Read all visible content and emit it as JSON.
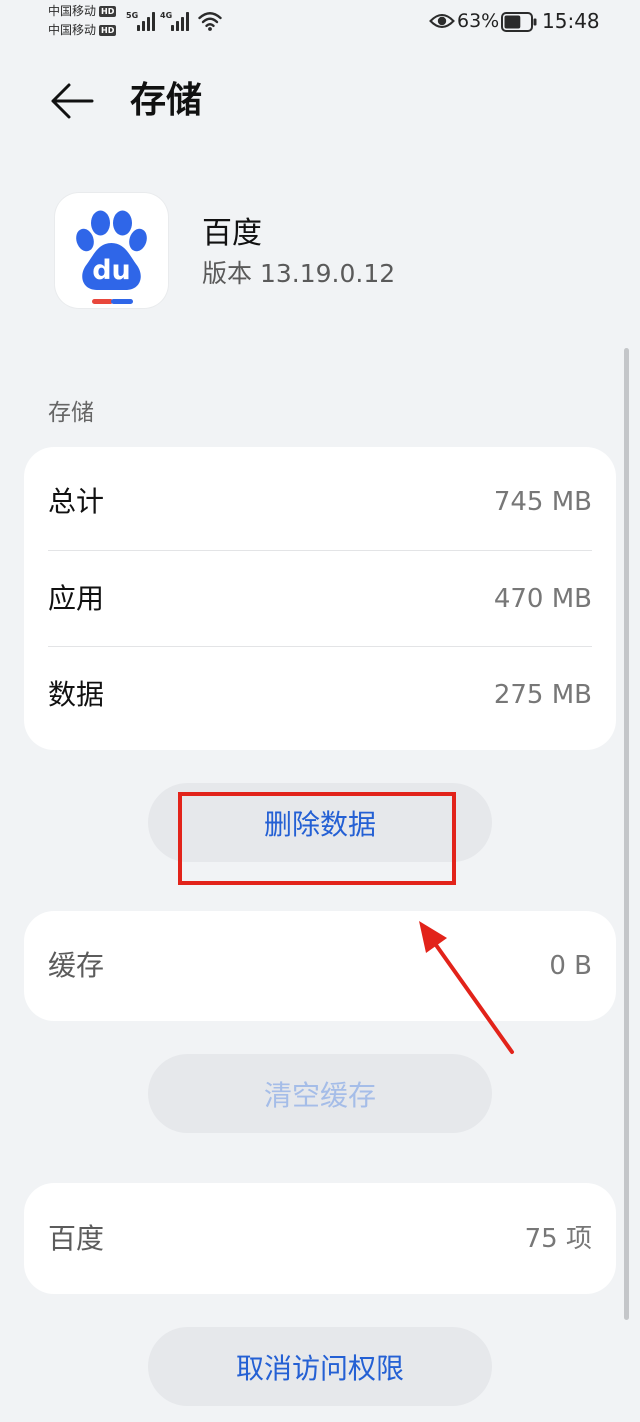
{
  "status_bar": {
    "carrier_1": "中国移动",
    "carrier_2": "中国移动",
    "hd_badge": "HD",
    "network_1": "5G",
    "network_2": "4G",
    "battery_percent": "63%",
    "battery_level": 0.63,
    "time": "15:48"
  },
  "header": {
    "title": "存储"
  },
  "app": {
    "name": "百度",
    "version": "版本 13.19.0.12",
    "logo_text": "du"
  },
  "storage_section": {
    "label": "存储",
    "rows": [
      {
        "label": "总计",
        "value": "745 MB"
      },
      {
        "label": "应用",
        "value": "470 MB"
      },
      {
        "label": "数据",
        "value": "275 MB"
      }
    ],
    "delete_button": "删除数据"
  },
  "cache": {
    "label": "缓存",
    "value": "0 B",
    "clear_button": "清空缓存"
  },
  "access": {
    "label": "百度",
    "value": "75 项",
    "revoke_button": "取消访问权限"
  },
  "icons": {
    "back": "back-arrow-icon",
    "signal": "signal-bars-icon",
    "wifi": "wifi-icon",
    "eye": "eye-icon",
    "battery": "battery-icon"
  },
  "colors": {
    "background": "#f1f3f5",
    "accent": "#2460d4",
    "disabled_text": "#a5bde8",
    "annotation": "#e2231a",
    "brand_blue": "#2f66e8",
    "brand_red": "#e8473c",
    "text_primary": "#111111"
  }
}
